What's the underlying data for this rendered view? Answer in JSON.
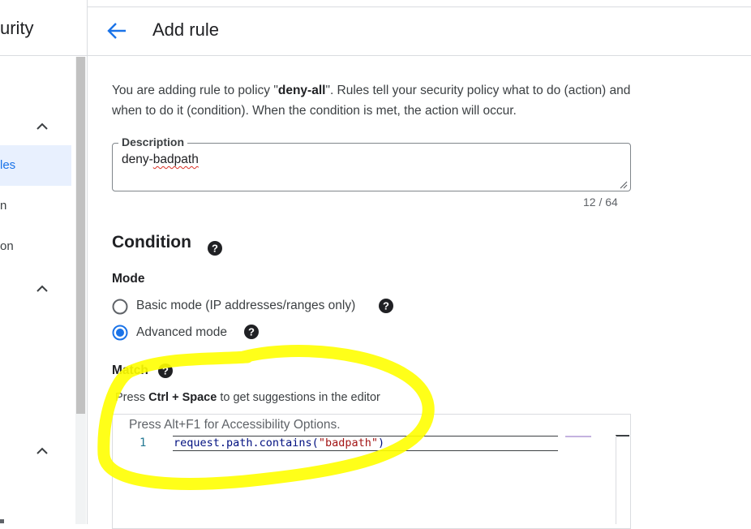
{
  "sidebar": {
    "title_fragment": "urity",
    "items": [
      {
        "label": "les",
        "active": true
      },
      {
        "label": "n",
        "active": false
      },
      {
        "label": "on",
        "active": false
      }
    ]
  },
  "header": {
    "back_icon": "arrow-back-icon",
    "title": "Add rule"
  },
  "intro": {
    "part1": "You are adding rule to policy \"",
    "policy_name": "deny-all",
    "part2": "\". Rules tell your security policy what to do (action) and when to do it (condition). When the condition is met, the action will occur."
  },
  "description": {
    "label": "Description",
    "value_prefix": "deny-",
    "value_misspelled": "badpath",
    "count": "12 / 64"
  },
  "condition": {
    "title": "Condition",
    "mode_label": "Mode",
    "modes": [
      {
        "label": "Basic mode (IP addresses/ranges only)",
        "selected": false
      },
      {
        "label": "Advanced mode",
        "selected": true
      }
    ],
    "match_label": "Match",
    "hint_prefix": "Press ",
    "hint_keys": "Ctrl + Space",
    "hint_suffix": " to get suggestions in the editor"
  },
  "editor": {
    "accessibility_hint": "Press Alt+F1 for Accessibility Options.",
    "line_number": "1",
    "code_prefix": "request.path.contains(",
    "code_string": "\"badpath\"",
    "code_suffix": ")"
  },
  "colors": {
    "accent": "#1a73e8",
    "annotation": "#ffff00",
    "text": "#202124"
  }
}
